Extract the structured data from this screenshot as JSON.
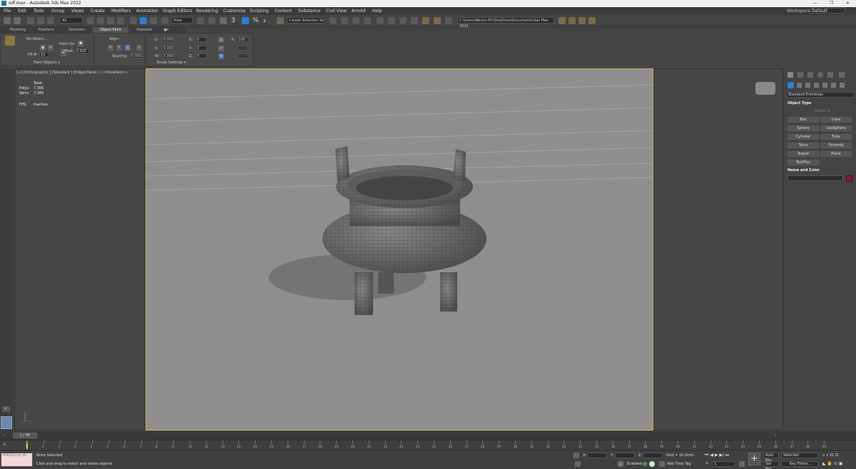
{
  "window": {
    "title": "sdf.max - Autodesk 3ds Max 2022",
    "min": "—",
    "max": "❐",
    "close": "✕"
  },
  "menu": [
    "File",
    "Edit",
    "Tools",
    "Group",
    "Views",
    "Create",
    "Modifiers",
    "Animation",
    "Graph Editors",
    "Rendering",
    "Customize",
    "Scripting",
    "Content",
    "Substance",
    "Civil View",
    "Arnold",
    "Help"
  ],
  "workspace": {
    "label": "Workspaces:",
    "value": "Default"
  },
  "toolbar": {
    "filter": "All",
    "view": "View",
    "selection_set": "Create Selection Se",
    "path": "C:\\Users\\Nesrin-PC\\OneDrive\\Documents\\3ds Max 2022",
    "snap_3": "3",
    "percent": "%",
    "spinner": "₃"
  },
  "tabs": [
    "Modeling",
    "Freeform",
    "Selection",
    "Object Paint",
    "Populate"
  ],
  "active_tab": "Object Paint",
  "ribbon": {
    "no_object": "No Object...",
    "paint_on": "Paint On:",
    "fill_label": "Fill #:",
    "fill_value": "10",
    "offset_label": "Offset:",
    "offset_value": "0.000",
    "align_label": "Align:",
    "x": "X",
    "y": "Y",
    "z": "Z",
    "spacing_label": "Spacing:",
    "spacing_value": "0.000",
    "paint_objects": "Paint Objects ▾",
    "brush_settings": "Brush Settings ▾",
    "u": "U:",
    "v": "V:",
    "w": "W:",
    "uv_value": "0.000",
    "x_label": "X:",
    "y_label": "Y:",
    "z_label": "Z:",
    "xyz_value": "0",
    "scale_x": "X:",
    "scale_x_value": "100"
  },
  "viewport": {
    "label": "[+] [Orthographic ] [Standard ] [Edged Faces ]  <<Disabled>>",
    "stats_total": "Total",
    "polys_label": "Polys:",
    "polys_value": "7,305",
    "verts_label": "Verts:",
    "verts_value": "7,365",
    "fps_label": "FPS:",
    "fps_value": "Inactive"
  },
  "command_panel": {
    "category": "Standard Primitives",
    "object_type": "Object Type",
    "autogrid": "AutoGrid",
    "buttons": [
      "Box",
      "Cone",
      "Sphere",
      "GeoSphere",
      "Cylinder",
      "Tube",
      "Torus",
      "Pyramid",
      "Teapot",
      "Plane",
      "TextPlus"
    ],
    "name_and_color": "Name and Color",
    "color": "#8b1a2c"
  },
  "timeline": {
    "frame": "1 / 40",
    "ticks": [
      "0",
      "1",
      "2",
      "3",
      "4",
      "5",
      "6",
      "7",
      "8",
      "9",
      "10",
      "11",
      "12",
      "13",
      "14",
      "15",
      "16",
      "17",
      "18",
      "19",
      "20",
      "21",
      "22",
      "23",
      "24",
      "25",
      "26",
      "27",
      "28",
      "29",
      "30",
      "31",
      "32",
      "33",
      "34",
      "35",
      "36",
      "37",
      "38",
      "39",
      "40",
      "41",
      "42",
      "43",
      "44",
      "45",
      "46",
      "47",
      "48",
      "49"
    ]
  },
  "status": {
    "maxscript": "MAXScript Mi",
    "selection": "None Selected",
    "prompt": "Click and drag to select and rotate objects",
    "x_label": "X:",
    "y_label": "Y:",
    "z_label": "Z:",
    "grid": "Grid = 10.0mm",
    "enabled": "Enabled:",
    "add_time_tag": "Add Time Tag",
    "auto_key": "Auto Key",
    "set_key": "Set Key",
    "selected": "Selected",
    "key_filters": "Key Filters...",
    "frame_value": "1"
  },
  "colors": {
    "accent": "#2a7fd4",
    "viewport_border": "#c8b650",
    "timeline_marker": "#e0d04a"
  }
}
